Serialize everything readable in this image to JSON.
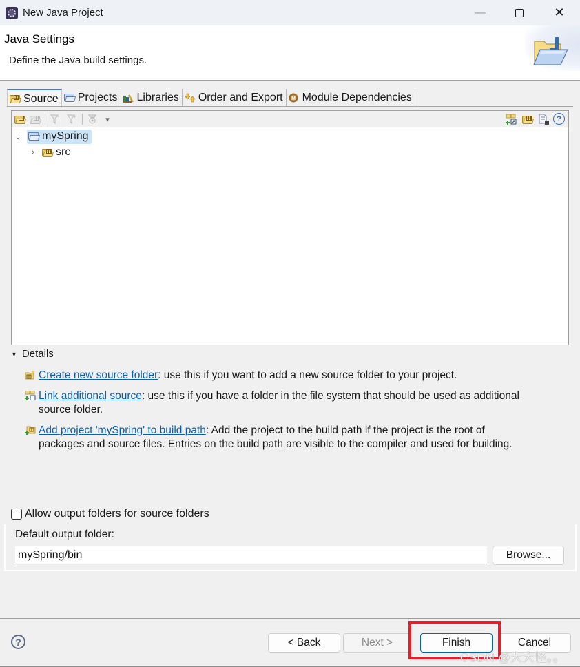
{
  "window": {
    "title": "New Java Project",
    "controls": {
      "minimize": "—",
      "close": "✕"
    }
  },
  "header": {
    "title": "Java Settings",
    "description": "Define the Java build settings."
  },
  "tabs": [
    {
      "label": "Source",
      "icon": "source-folder-icon",
      "active": true
    },
    {
      "label": "Projects",
      "icon": "projects-icon",
      "active": false
    },
    {
      "label": "Libraries",
      "icon": "libraries-icon",
      "active": false
    },
    {
      "label": "Order and Export",
      "icon": "order-export-icon",
      "active": false
    },
    {
      "label": "Module Dependencies",
      "icon": "module-icon",
      "active": false
    }
  ],
  "toolbar": {
    "left_icons": [
      "add-source-folder-icon",
      "remove-source-folder-icon",
      "include-filter-icon",
      "exclusion-filter-icon",
      "output-folder-icon",
      "dropdown-arrow-icon"
    ],
    "right_icons": [
      "link-source-icon",
      "new-source-folder-icon",
      "remove-icon",
      "help-icon"
    ],
    "dropdown_glyph": "▾",
    "help_glyph": "?"
  },
  "tree": {
    "root": {
      "label": "mySpring",
      "expanded": true,
      "selected": true,
      "chevron": "⌄"
    },
    "children": [
      {
        "label": "src",
        "expanded": false,
        "chevron": "›"
      }
    ]
  },
  "details": {
    "title": "Details",
    "toggle_glyph": "▼",
    "items": [
      {
        "icon": "new-source-folder-icon",
        "link": "Create new source folder",
        "text": ": use this if you want to add a new source folder to your project.",
        "continuation": ""
      },
      {
        "icon": "link-source-icon",
        "link": "Link additional source",
        "text": ": use this if you have a folder in the file system that should be used as additional",
        "continuation": "source folder."
      },
      {
        "icon": "add-project-build-path-icon",
        "link": "Add project 'mySpring' to build path",
        "text": ": Add the project to the build path if the project is the root of",
        "continuation": "packages and source files. Entries on the build path are visible to the compiler and used for building."
      }
    ]
  },
  "options": {
    "allow_output_folders": {
      "label": "Allow output folders for source folders",
      "checked": false
    },
    "default_output_folder": {
      "label": "Default output folder:",
      "value": "mySpring/bin"
    },
    "browse_label": "Browse..."
  },
  "footer": {
    "help_glyph": "?",
    "back_label": "< Back",
    "next_label": "Next >",
    "finish_label": "Finish",
    "cancel_label": "Cancel"
  },
  "annotation": {
    "highlight_color": "#e81c2a",
    "watermark": "CSDN @大大怪。。"
  },
  "colors": {
    "accent": "#3c7dd8",
    "link": "#0a5fb4",
    "selection": "#cce4f7",
    "default_button_border": "#0067c0"
  }
}
